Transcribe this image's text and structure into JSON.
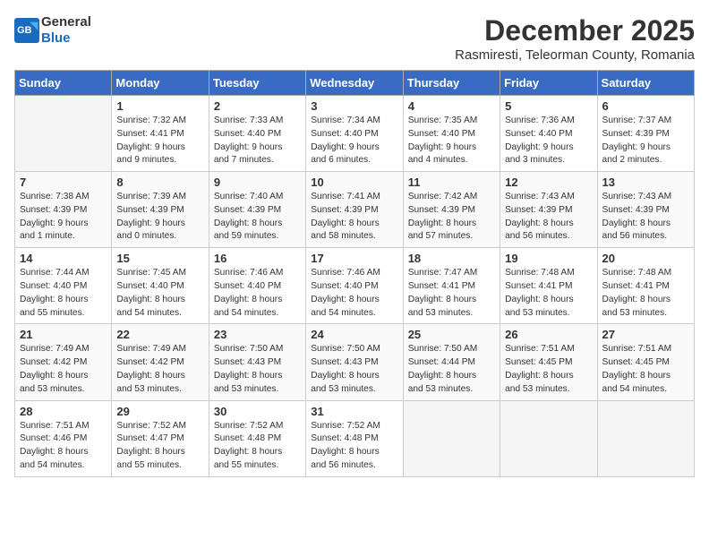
{
  "header": {
    "logo_general": "General",
    "logo_blue": "Blue",
    "month_year": "December 2025",
    "location": "Rasmiresti, Teleorman County, Romania"
  },
  "columns": [
    "Sunday",
    "Monday",
    "Tuesday",
    "Wednesday",
    "Thursday",
    "Friday",
    "Saturday"
  ],
  "weeks": [
    [
      {
        "day": "",
        "info": ""
      },
      {
        "day": "1",
        "info": "Sunrise: 7:32 AM\nSunset: 4:41 PM\nDaylight: 9 hours\nand 9 minutes."
      },
      {
        "day": "2",
        "info": "Sunrise: 7:33 AM\nSunset: 4:40 PM\nDaylight: 9 hours\nand 7 minutes."
      },
      {
        "day": "3",
        "info": "Sunrise: 7:34 AM\nSunset: 4:40 PM\nDaylight: 9 hours\nand 6 minutes."
      },
      {
        "day": "4",
        "info": "Sunrise: 7:35 AM\nSunset: 4:40 PM\nDaylight: 9 hours\nand 4 minutes."
      },
      {
        "day": "5",
        "info": "Sunrise: 7:36 AM\nSunset: 4:40 PM\nDaylight: 9 hours\nand 3 minutes."
      },
      {
        "day": "6",
        "info": "Sunrise: 7:37 AM\nSunset: 4:39 PM\nDaylight: 9 hours\nand 2 minutes."
      }
    ],
    [
      {
        "day": "7",
        "info": "Sunrise: 7:38 AM\nSunset: 4:39 PM\nDaylight: 9 hours\nand 1 minute."
      },
      {
        "day": "8",
        "info": "Sunrise: 7:39 AM\nSunset: 4:39 PM\nDaylight: 9 hours\nand 0 minutes."
      },
      {
        "day": "9",
        "info": "Sunrise: 7:40 AM\nSunset: 4:39 PM\nDaylight: 8 hours\nand 59 minutes."
      },
      {
        "day": "10",
        "info": "Sunrise: 7:41 AM\nSunset: 4:39 PM\nDaylight: 8 hours\nand 58 minutes."
      },
      {
        "day": "11",
        "info": "Sunrise: 7:42 AM\nSunset: 4:39 PM\nDaylight: 8 hours\nand 57 minutes."
      },
      {
        "day": "12",
        "info": "Sunrise: 7:43 AM\nSunset: 4:39 PM\nDaylight: 8 hours\nand 56 minutes."
      },
      {
        "day": "13",
        "info": "Sunrise: 7:43 AM\nSunset: 4:39 PM\nDaylight: 8 hours\nand 56 minutes."
      }
    ],
    [
      {
        "day": "14",
        "info": "Sunrise: 7:44 AM\nSunset: 4:40 PM\nDaylight: 8 hours\nand 55 minutes."
      },
      {
        "day": "15",
        "info": "Sunrise: 7:45 AM\nSunset: 4:40 PM\nDaylight: 8 hours\nand 54 minutes."
      },
      {
        "day": "16",
        "info": "Sunrise: 7:46 AM\nSunset: 4:40 PM\nDaylight: 8 hours\nand 54 minutes."
      },
      {
        "day": "17",
        "info": "Sunrise: 7:46 AM\nSunset: 4:40 PM\nDaylight: 8 hours\nand 54 minutes."
      },
      {
        "day": "18",
        "info": "Sunrise: 7:47 AM\nSunset: 4:41 PM\nDaylight: 8 hours\nand 53 minutes."
      },
      {
        "day": "19",
        "info": "Sunrise: 7:48 AM\nSunset: 4:41 PM\nDaylight: 8 hours\nand 53 minutes."
      },
      {
        "day": "20",
        "info": "Sunrise: 7:48 AM\nSunset: 4:41 PM\nDaylight: 8 hours\nand 53 minutes."
      }
    ],
    [
      {
        "day": "21",
        "info": "Sunrise: 7:49 AM\nSunset: 4:42 PM\nDaylight: 8 hours\nand 53 minutes."
      },
      {
        "day": "22",
        "info": "Sunrise: 7:49 AM\nSunset: 4:42 PM\nDaylight: 8 hours\nand 53 minutes."
      },
      {
        "day": "23",
        "info": "Sunrise: 7:50 AM\nSunset: 4:43 PM\nDaylight: 8 hours\nand 53 minutes."
      },
      {
        "day": "24",
        "info": "Sunrise: 7:50 AM\nSunset: 4:43 PM\nDaylight: 8 hours\nand 53 minutes."
      },
      {
        "day": "25",
        "info": "Sunrise: 7:50 AM\nSunset: 4:44 PM\nDaylight: 8 hours\nand 53 minutes."
      },
      {
        "day": "26",
        "info": "Sunrise: 7:51 AM\nSunset: 4:45 PM\nDaylight: 8 hours\nand 53 minutes."
      },
      {
        "day": "27",
        "info": "Sunrise: 7:51 AM\nSunset: 4:45 PM\nDaylight: 8 hours\nand 54 minutes."
      }
    ],
    [
      {
        "day": "28",
        "info": "Sunrise: 7:51 AM\nSunset: 4:46 PM\nDaylight: 8 hours\nand 54 minutes."
      },
      {
        "day": "29",
        "info": "Sunrise: 7:52 AM\nSunset: 4:47 PM\nDaylight: 8 hours\nand 55 minutes."
      },
      {
        "day": "30",
        "info": "Sunrise: 7:52 AM\nSunset: 4:48 PM\nDaylight: 8 hours\nand 55 minutes."
      },
      {
        "day": "31",
        "info": "Sunrise: 7:52 AM\nSunset: 4:48 PM\nDaylight: 8 hours\nand 56 minutes."
      },
      {
        "day": "",
        "info": ""
      },
      {
        "day": "",
        "info": ""
      },
      {
        "day": "",
        "info": ""
      }
    ]
  ]
}
